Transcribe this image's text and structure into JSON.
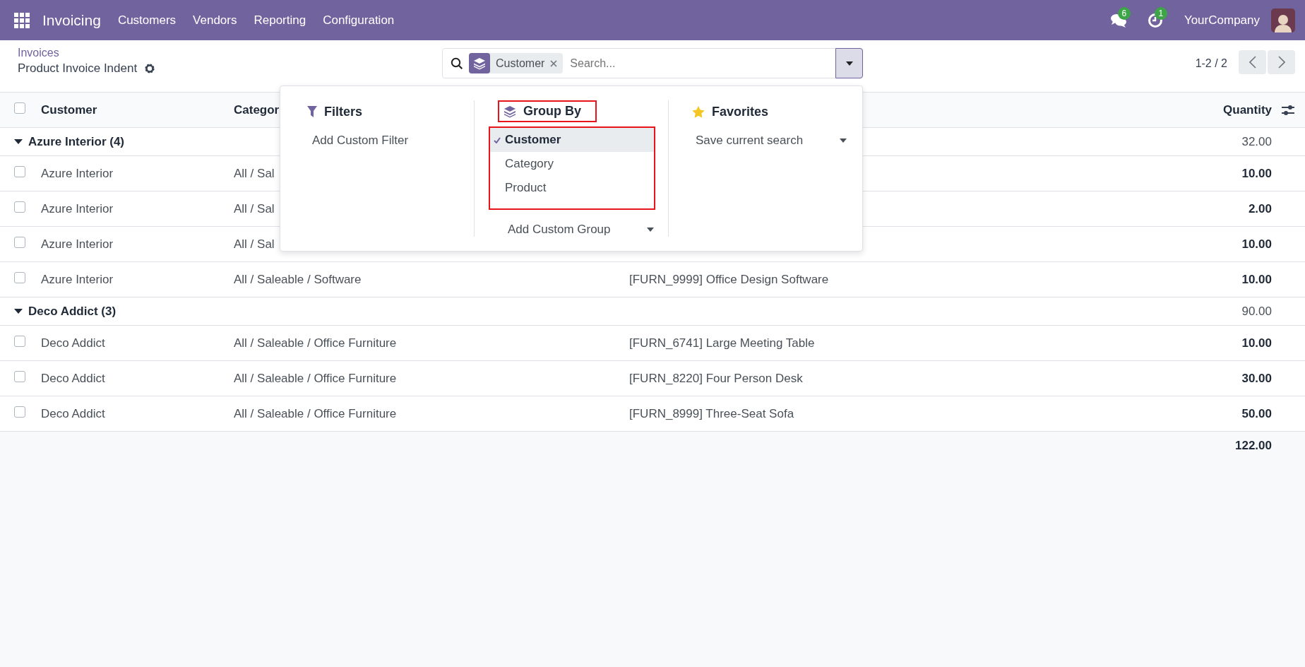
{
  "navbar": {
    "app": "Invoicing",
    "menu": [
      "Customers",
      "Vendors",
      "Reporting",
      "Configuration"
    ],
    "messages_badge": "6",
    "activities_badge": "1",
    "company": "YourCompany"
  },
  "breadcrumb": {
    "parent": "Invoices",
    "current": "Product Invoice Indent"
  },
  "search": {
    "facet": "Customer",
    "placeholder": "Search..."
  },
  "pager": "1-2 / 2",
  "table": {
    "select_all_checked": false,
    "columns": [
      "Customer",
      "Categor",
      "Quantity"
    ],
    "groups": [
      {
        "label": "Azure Interior (4)",
        "expanded": true,
        "total": "32.00",
        "rows": [
          {
            "customer": "Azure Interior",
            "category": "All / Sal",
            "quantity": "10.00",
            "checked": false
          },
          {
            "customer": "Azure Interior",
            "category": "All / Sal",
            "quantity": "2.00",
            "checked": false
          },
          {
            "customer": "Azure Interior",
            "category": "All / Sal",
            "quantity": "10.00",
            "checked": false
          },
          {
            "customer": "Azure Interior",
            "category": "All / Saleable / Software",
            "product": "[FURN_9999] Office Design Software",
            "quantity": "10.00",
            "checked": false
          }
        ]
      },
      {
        "label": "Deco Addict (3)",
        "expanded": true,
        "total": "90.00",
        "rows": [
          {
            "customer": "Deco Addict",
            "category": "All / Saleable / Office Furniture",
            "product": "[FURN_6741] Large Meeting Table",
            "quantity": "10.00",
            "checked": false
          },
          {
            "customer": "Deco Addict",
            "category": "All / Saleable / Office Furniture",
            "product": "[FURN_8220] Four Person Desk",
            "quantity": "30.00",
            "checked": false
          },
          {
            "customer": "Deco Addict",
            "category": "All / Saleable / Office Furniture",
            "product": "[FURN_8999] Three-Seat Sofa",
            "quantity": "50.00",
            "checked": false
          }
        ]
      }
    ],
    "total": "122.00"
  },
  "dropdown": {
    "filters": {
      "title": "Filters",
      "items": [
        "Add Custom Filter"
      ]
    },
    "group_by": {
      "title": "Group By",
      "highlighted": true,
      "options_highlighted": true,
      "options": [
        {
          "label": "Customer",
          "selected": true
        },
        {
          "label": "Category",
          "selected": false
        },
        {
          "label": "Product",
          "selected": false
        }
      ],
      "custom": "Add Custom Group"
    },
    "favorites": {
      "title": "Favorites",
      "items": [
        "Save current search"
      ]
    }
  }
}
